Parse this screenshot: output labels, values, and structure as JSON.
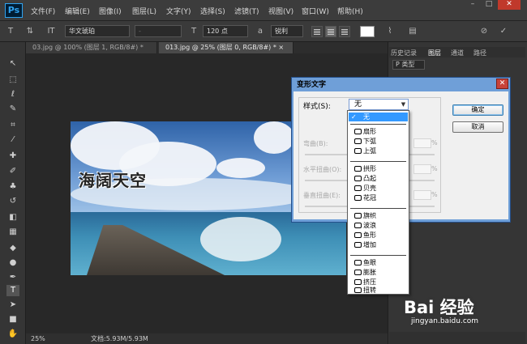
{
  "menubar": {
    "logo": "Ps",
    "items": [
      "文件(F)",
      "编辑(E)",
      "图像(I)",
      "图层(L)",
      "文字(Y)",
      "选择(S)",
      "滤镜(T)",
      "视图(V)",
      "窗口(W)",
      "帮助(H)"
    ],
    "min": "–",
    "max": "□",
    "close": "✕"
  },
  "options": {
    "font_family": "华文琥珀",
    "font_style": "-",
    "font_size": "120 点",
    "antialias": "锐利"
  },
  "tabs": [
    {
      "label": "03.jpg @ 100% (图层 1, RGB/8#) * ×"
    },
    {
      "label": "013.jpg @ 25% (图层 0, RGB/8#) * ×"
    }
  ],
  "canvas": {
    "text": "海阔天空"
  },
  "status": {
    "zoom": "25%",
    "doc": "文档:5.93M/5.93M"
  },
  "right_panel": {
    "tabs": [
      "历史记录",
      "图层",
      "通道",
      "路径"
    ],
    "filter": "P 类型"
  },
  "dialog": {
    "title": "变形文字",
    "style_label": "样式(S):",
    "style_value": "无",
    "ok": "确定",
    "cancel": "取消",
    "fields": [
      {
        "label": "弯曲(B):",
        "pct": "%"
      },
      {
        "label": "水平扭曲(O):",
        "pct": "%"
      },
      {
        "label": "垂直扭曲(E):",
        "pct": "%"
      }
    ]
  },
  "dropdown": {
    "items": [
      "无",
      "扇形",
      "下弧",
      "上弧",
      "拱形",
      "凸起",
      "贝壳",
      "花冠",
      "旗帜",
      "波浪",
      "鱼形",
      "增加",
      "鱼眼",
      "膨胀",
      "挤压",
      "扭转"
    ]
  },
  "watermark": {
    "logo": "Bai 经验",
    "sub": "jingyan.baidu.com"
  }
}
